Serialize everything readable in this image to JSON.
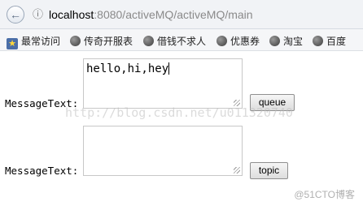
{
  "browser": {
    "address": {
      "host": "localhost",
      "rest": ":8080/activeMQ/activeMQ/main"
    },
    "bookmarks": [
      {
        "label": "最常访问",
        "icon": "bookmark-star-icon"
      },
      {
        "label": "传奇开服表",
        "icon": "globe-icon"
      },
      {
        "label": "借钱不求人",
        "icon": "globe-icon"
      },
      {
        "label": "优惠券",
        "icon": "globe-icon"
      },
      {
        "label": "淘宝",
        "icon": "globe-icon"
      },
      {
        "label": "百度",
        "icon": "globe-icon"
      }
    ]
  },
  "form": {
    "queue": {
      "label": "MessageText:",
      "value": "hello,hi,hey",
      "button": "queue"
    },
    "topic": {
      "label": "MessageText:",
      "value": "",
      "button": "topic"
    }
  },
  "watermarks": {
    "center": "http://blog.csdn.net/u011320740",
    "corner": "@51CTO博客"
  }
}
